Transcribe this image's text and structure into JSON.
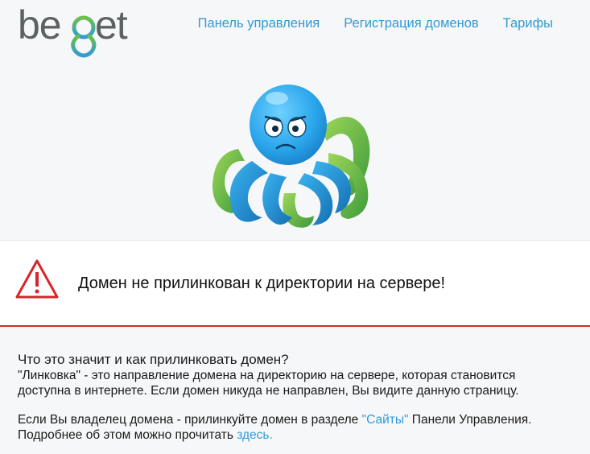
{
  "logo": {
    "text": "beget"
  },
  "nav": [
    {
      "label": "Панель управления"
    },
    {
      "label": "Регистрация доменов"
    },
    {
      "label": "Тарифы"
    }
  ],
  "alert": {
    "message": "Домен не прилинкован к директории на сервере!",
    "accent_color": "#d9252b"
  },
  "info": {
    "question": "Что это значит и как прилинковать домен?",
    "paragraph1_line1": "\"Линковка\" - это направление домена на директорию на сервере, которая становится",
    "paragraph1_line2": "доступна в интернете. Если домен никуда не направлен, Вы видите данную страницу.",
    "paragraph2_prefix": "Если Вы владелец домена - прилинкуйте домен в разделе ",
    "paragraph2_link": "\"Сайты\"",
    "paragraph2_suffix": " Панели Управления.",
    "paragraph3_prefix": "Подробнее об этом можно прочитать ",
    "paragraph3_link": "здесь."
  },
  "colors": {
    "link": "#2f9bd6",
    "background": "#f6f7f8",
    "logo_gray": "#5c6164",
    "logo_green": "#6cc04a",
    "logo_blue": "#2f9bd6"
  }
}
